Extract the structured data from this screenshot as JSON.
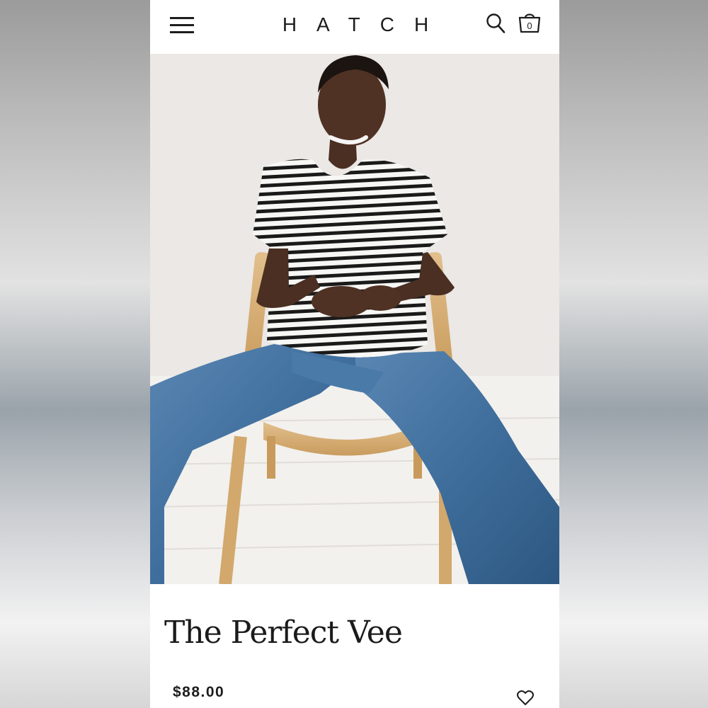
{
  "header": {
    "brand": "HATCH",
    "cart_count": "0",
    "icons": {
      "menu": "hamburger-menu-icon",
      "search": "search-icon",
      "cart": "shopping-bag-icon"
    }
  },
  "product": {
    "image_alt": "Model seated on a wooden chair wearing a black and white striped v-neck tee and blue jeans",
    "title": "The Perfect Vee",
    "price": "$88.00",
    "wishlist_icon": "heart-icon"
  },
  "colors": {
    "background": "#ffffff",
    "text": "#1d1d1d",
    "denim": "#3f6e9c",
    "stripe_dark": "#1a1a1a",
    "chair_wood": "#d9b27a",
    "wall": "#ece9e6"
  }
}
